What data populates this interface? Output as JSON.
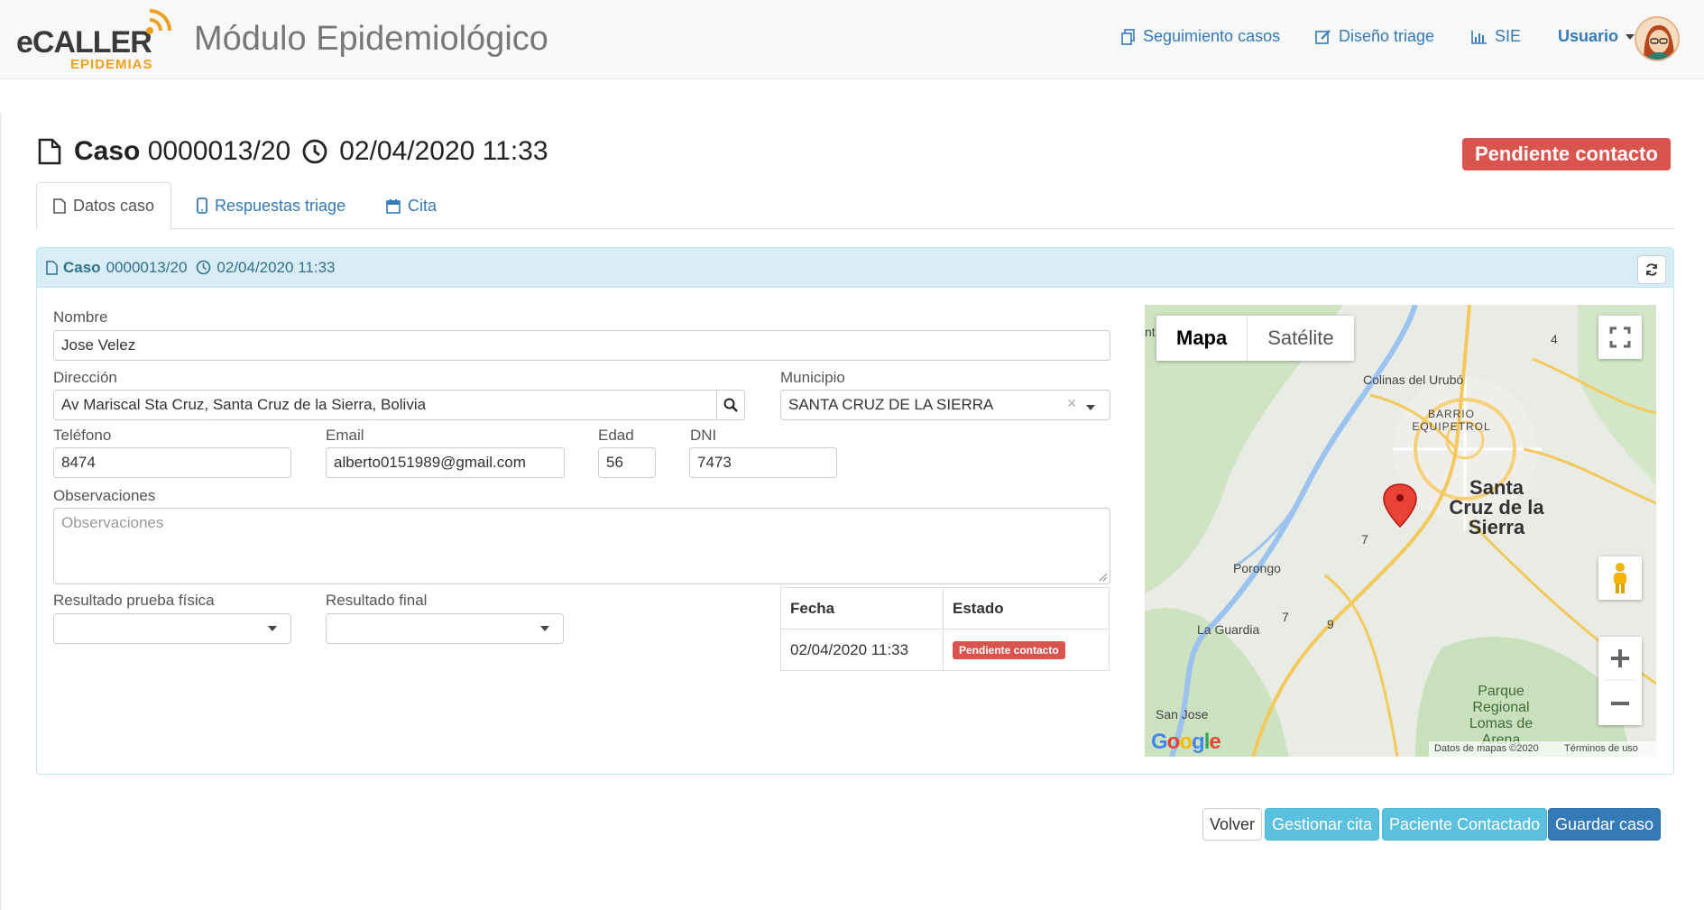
{
  "navbar": {
    "logo_main": "eCALLER",
    "logo_sub": "EPIDEMIAS",
    "app_title": "Módulo Epidemiológico",
    "links": [
      {
        "label": "Seguimiento casos",
        "icon": "copy-icon"
      },
      {
        "label": "Diseño triage",
        "icon": "edit-icon"
      },
      {
        "label": "SIE",
        "icon": "bar-chart-icon"
      }
    ],
    "user_label": "Usuario"
  },
  "header": {
    "case_word": "Caso",
    "case_number": "0000013/20",
    "datetime": "02/04/2020 11:33",
    "status": "Pendiente contacto"
  },
  "tabs": [
    {
      "label": "Datos caso",
      "icon": "file-icon",
      "active": true
    },
    {
      "label": "Respuestas triage",
      "icon": "mobile-icon",
      "active": false
    },
    {
      "label": "Cita",
      "icon": "calendar-icon",
      "active": false
    }
  ],
  "panel": {
    "heading_case_word": "Caso",
    "heading_case_number": "0000013/20",
    "heading_datetime": "02/04/2020 11:33"
  },
  "form": {
    "nombre_label": "Nombre",
    "nombre_value": "Jose Velez",
    "direccion_label": "Dirección",
    "direccion_value": "Av Mariscal Sta Cruz, Santa Cruz de la Sierra, Bolivia",
    "municipio_label": "Municipio",
    "municipio_value": "SANTA CRUZ DE LA SIERRA",
    "telefono_label": "Teléfono",
    "telefono_value": "8474",
    "email_label": "Email",
    "email_value": "alberto0151989@gmail.com",
    "edad_label": "Edad",
    "edad_value": "56",
    "dni_label": "DNI",
    "dni_value": "7473",
    "observaciones_label": "Observaciones",
    "observaciones_placeholder": "Observaciones",
    "resultado_fisica_label": "Resultado prueba física",
    "resultado_final_label": "Resultado final"
  },
  "history": {
    "headers": [
      "Fecha",
      "Estado"
    ],
    "rows": [
      {
        "fecha": "02/04/2020 11:33",
        "estado": "Pendiente contacto"
      }
    ]
  },
  "map": {
    "type_map": "Mapa",
    "type_satellite": "Satélite",
    "labels": {
      "colinas": "Colinas del Urubó",
      "barrio": "BARRIO EQUIPETROL",
      "city": "Santa Cruz de la Sierra",
      "porongo": "Porongo",
      "la_guardia": "La Guardia",
      "san_jose": "San Jose",
      "parque": "Parque Regional Lomas de Arena",
      "route_4": "4",
      "route_7a": "7",
      "route_7b": "7",
      "route_9": "9",
      "edge_left": "nt",
      "google": "Google"
    },
    "footer_data": "Datos de mapas ©2020",
    "footer_terms": "Términos de uso"
  },
  "buttons": {
    "volver": "Volver",
    "gestionar": "Gestionar cita",
    "contactado": "Paciente Contactado",
    "guardar": "Guardar caso"
  },
  "colors": {
    "primary": "#337ab7",
    "danger": "#d9534f",
    "info": "#5bc0de",
    "panel_heading": "#d9edf7"
  }
}
